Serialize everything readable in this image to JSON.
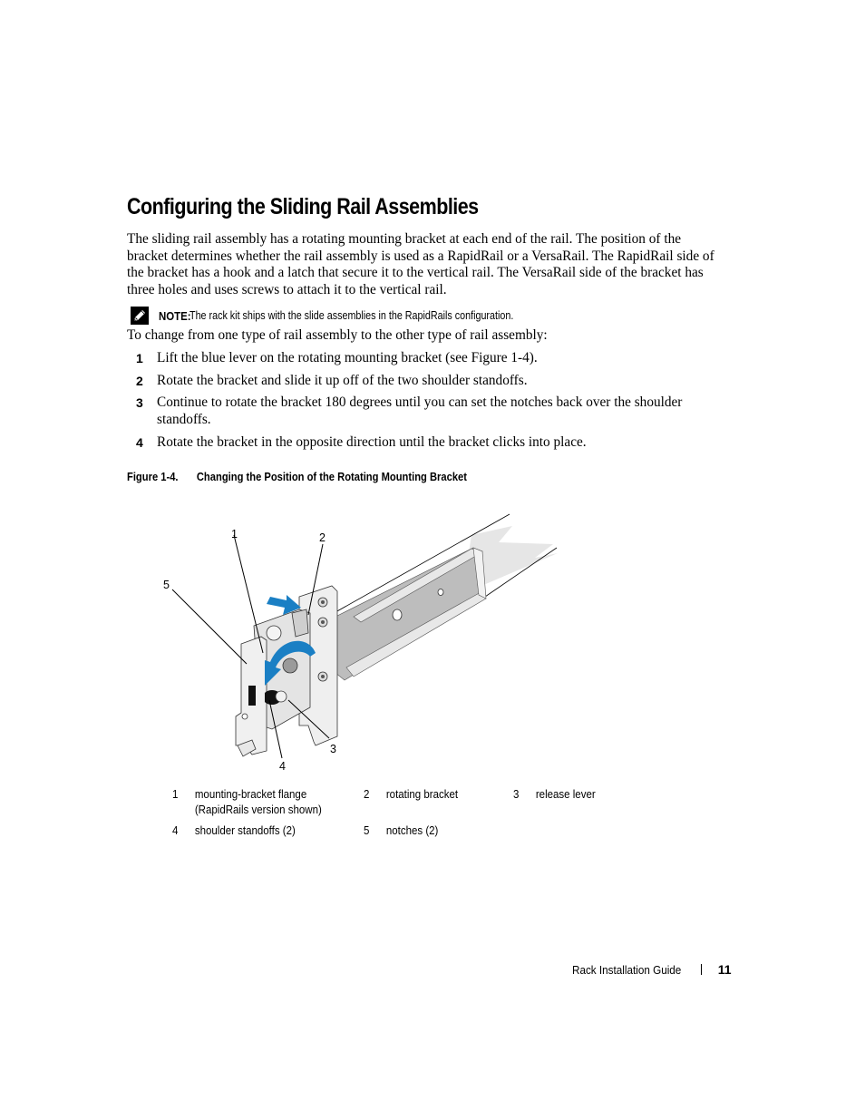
{
  "section": {
    "title": "Configuring the Sliding Rail Assemblies",
    "paragraph_lines": [
      "The sliding rail assembly has a rotating mounting bracket at each end of the rail. The position of the",
      "bracket determines whether the rail assembly is used as a RapidRail or a VersaRail. The RapidRail side of",
      "the bracket has a hook and a latch that secure it to the vertical rail. The VersaRail side of the bracket has",
      "three holes and uses screws to attach it to the vertical rail."
    ]
  },
  "note": {
    "icon": "pencil-note-icon",
    "label": "NOTE:",
    "text": "The rack kit ships with the slide assemblies in the RapidRails configuration."
  },
  "procedure": {
    "intro": "To change from one type of rail assembly to the other type of rail assembly:",
    "steps": [
      {
        "num": "1",
        "text": "Lift the blue lever on the rotating mounting bracket (see Figure 1-4)."
      },
      {
        "num": "2",
        "text": "Rotate the bracket and slide it up off of the two shoulder standoffs."
      },
      {
        "num": "3",
        "text": "Continue to rotate the bracket 180 degrees until you can set the notches back over the shoulder standoffs."
      },
      {
        "num": "4",
        "text": "Rotate the bracket in the opposite direction until the bracket clicks into place."
      }
    ]
  },
  "figure": {
    "number": "Figure 1-4.",
    "caption": "Changing the Position of the Rotating Mounting Bracket",
    "accent_color": "#1a7fc4",
    "callouts": [
      "1",
      "2",
      "3",
      "4",
      "5"
    ],
    "legend": [
      {
        "num": "1",
        "text": "mounting-bracket flange",
        "text2": "(RapidRails version shown)"
      },
      {
        "num": "2",
        "text": "rotating bracket"
      },
      {
        "num": "3",
        "text": "release lever"
      },
      {
        "num": "4",
        "text": "shoulder standoffs (2)"
      },
      {
        "num": "5",
        "text": "notches (2)"
      }
    ]
  },
  "footer": {
    "title": "Rack Installation Guide",
    "page_number": "11"
  }
}
